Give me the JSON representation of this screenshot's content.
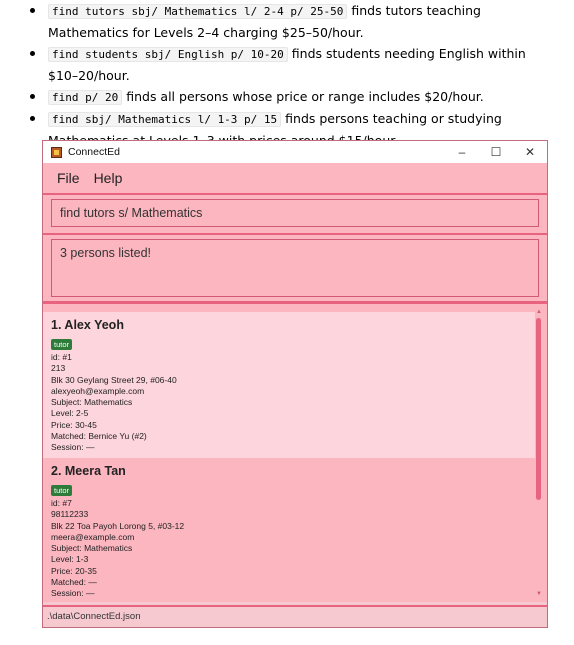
{
  "doc": {
    "items": [
      {
        "code": "find tutors sbj/ Mathematics l/ 2-4 p/ 25-50",
        "text": " finds tutors teaching Mathematics for Levels 2–4 charging $25–50/hour."
      },
      {
        "code": "find students sbj/ English p/ 10-20",
        "text": " finds students needing English within $10–20/hour."
      },
      {
        "code": "find p/ 20",
        "text": " finds all persons whose price or range includes $20/hour."
      },
      {
        "code": "find sbj/ Mathematics l/ 1-3 p/ 15",
        "text": " finds persons teaching or studying Mathematics at Levels 1–3 with prices around $15/hour."
      }
    ]
  },
  "window": {
    "title": "ConnectEd",
    "controls": {
      "minimize": "–",
      "maximize": "☐",
      "close": "✕"
    }
  },
  "menu": {
    "file": "File",
    "help": "Help"
  },
  "command": {
    "value": "find tutors s/ Mathematics"
  },
  "result": {
    "message": "3 persons listed!"
  },
  "persons": [
    {
      "name": "1. Alex Yeoh",
      "tag": "tutor",
      "id": "id: #1",
      "phone": "213",
      "address": "Blk 30 Geylang Street 29, #06-40",
      "email": "alexyeoh@example.com",
      "subject": "Subject: Mathematics",
      "level": "Level: 2-5",
      "price": "Price: 30-45",
      "matched": "Matched: Bernice Yu (#2)",
      "session": "Session: —"
    },
    {
      "name": "2. Meera Tan",
      "tag": "tutor",
      "id": "id: #7",
      "phone": "98112233",
      "address": "Blk 22 Toa Payoh Lorong 5, #03-12",
      "email": "meera@example.com",
      "subject": "Subject: Mathematics",
      "level": "Level: 1-3",
      "price": "Price: 20-35",
      "matched": "Matched: —",
      "session": "Session: —"
    }
  ],
  "status": {
    "path": ".\\data\\ConnectEd.json"
  },
  "colors": {
    "background": "#fbb6c0",
    "accent": "#e8637f",
    "tag": "#2f7b3a",
    "selected": "#fdd5dc"
  }
}
